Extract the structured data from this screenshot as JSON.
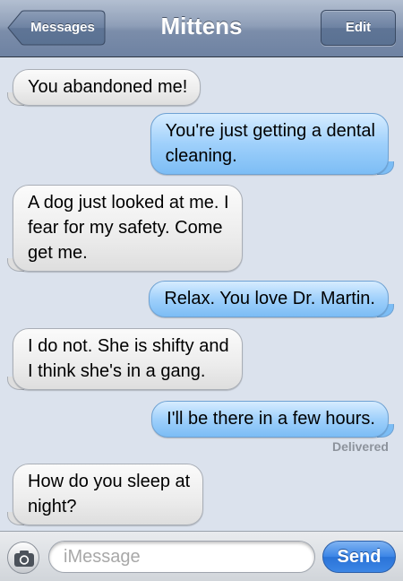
{
  "nav": {
    "back_label": "Messages",
    "title": "Mittens",
    "edit_label": "Edit"
  },
  "messages": [
    {
      "side": "incoming",
      "text": "You abandoned me!"
    },
    {
      "side": "outgoing",
      "text": "You're just getting a dental\ncleaning."
    },
    {
      "side": "incoming",
      "text": "A dog just looked at me. I\nfear for my safety. Come\nget me."
    },
    {
      "side": "outgoing",
      "text": "Relax. You love Dr. Martin."
    },
    {
      "side": "incoming",
      "text": "I do not. She is shifty and\nI think she's in a gang."
    },
    {
      "side": "outgoing",
      "text": "I'll be there in a few hours."
    },
    {
      "side": "incoming",
      "text": "How do you sleep at\nnight?"
    }
  ],
  "status": {
    "delivered": "Delivered"
  },
  "compose": {
    "placeholder": "iMessage",
    "send_label": "Send",
    "camera_icon": "camera-icon"
  },
  "colors": {
    "incoming_bubble": "#ececec",
    "outgoing_bubble": "#9fd0fb",
    "send_button": "#3b85e6",
    "background": "#dbe2ed"
  }
}
